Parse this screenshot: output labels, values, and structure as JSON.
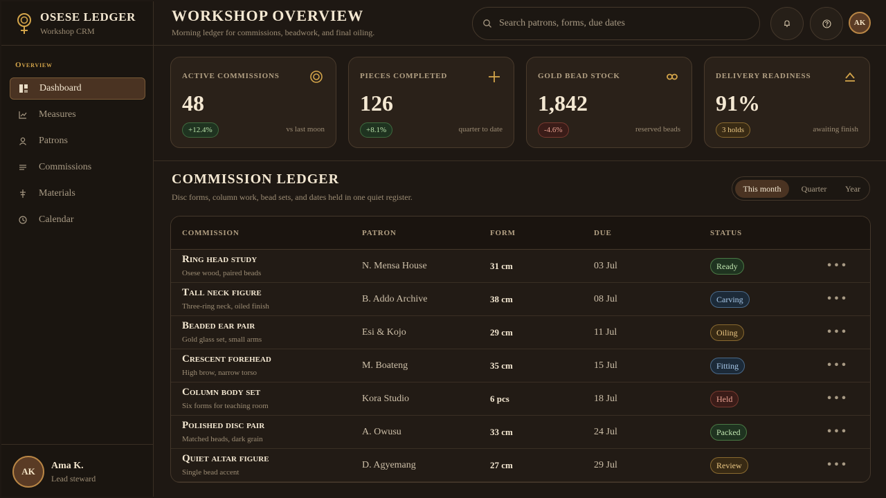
{
  "brand": {
    "title": "OSESE LEDGER",
    "subtitle": "Workshop CRM"
  },
  "sidebar": {
    "section": "Overview",
    "items": [
      {
        "label": "Dashboard",
        "icon": "dashboard-icon",
        "active": true
      },
      {
        "label": "Measures",
        "icon": "chart-icon"
      },
      {
        "label": "Patrons",
        "icon": "person-icon"
      },
      {
        "label": "Commissions",
        "icon": "list-icon"
      },
      {
        "label": "Materials",
        "icon": "materials-icon"
      },
      {
        "label": "Calendar",
        "icon": "clock-icon"
      }
    ],
    "user": {
      "initials": "AK",
      "name": "Ama K.",
      "role": "Lead steward"
    }
  },
  "header": {
    "title": "WORKSHOP OVERVIEW",
    "subtitle": "Morning ledger for commissions, beadwork, and final oiling.",
    "search_placeholder": "Search patrons, forms, due dates",
    "avatar_initials": "AK"
  },
  "stats": [
    {
      "label": "ACTIVE COMMISSIONS",
      "value": "48",
      "delta": "+12.4%",
      "tone": "green",
      "note": "vs last moon",
      "icon": "target-icon"
    },
    {
      "label": "PIECES COMPLETED",
      "value": "126",
      "delta": "+8.1%",
      "tone": "green",
      "note": "quarter to date",
      "icon": "plus-icon"
    },
    {
      "label": "GOLD BEAD STOCK",
      "value": "1,842",
      "delta": "-4.6%",
      "tone": "red",
      "note": "reserved beads",
      "icon": "infinity-icon"
    },
    {
      "label": "DELIVERY READINESS",
      "value": "91%",
      "delta": "3 holds",
      "tone": "amber",
      "note": "awaiting finish",
      "icon": "triangle-icon"
    }
  ],
  "ledger": {
    "title": "COMMISSION LEDGER",
    "subtitle": "Disc forms, column work, bead sets, and dates held in one quiet register.",
    "periods": [
      "This month",
      "Quarter",
      "Year"
    ],
    "active_period": "This month",
    "columns": [
      "COMMISSION",
      "PATRON",
      "FORM",
      "DUE",
      "STATUS"
    ],
    "rows": [
      {
        "title": "Ring head study",
        "desc": "Osese wood, paired beads",
        "patron": "N. Mensa House",
        "form": "31 cm",
        "due": "03 Jul",
        "status": "Ready",
        "tone": "green"
      },
      {
        "title": "Tall neck figure",
        "desc": "Three-ring neck, oiled finish",
        "patron": "B. Addo Archive",
        "form": "38 cm",
        "due": "08 Jul",
        "status": "Carving",
        "tone": "blue"
      },
      {
        "title": "Beaded ear pair",
        "desc": "Gold glass set, small arms",
        "patron": "Esi & Kojo",
        "form": "29 cm",
        "due": "11 Jul",
        "status": "Oiling",
        "tone": "amber"
      },
      {
        "title": "Crescent forehead",
        "desc": "High brow, narrow torso",
        "patron": "M. Boateng",
        "form": "35 cm",
        "due": "15 Jul",
        "status": "Fitting",
        "tone": "blue"
      },
      {
        "title": "Column body set",
        "desc": "Six forms for teaching room",
        "patron": "Kora Studio",
        "form": "6 pcs",
        "due": "18 Jul",
        "status": "Held",
        "tone": "red"
      },
      {
        "title": "Polished disc pair",
        "desc": "Matched heads, dark grain",
        "patron": "A. Owusu",
        "form": "33 cm",
        "due": "24 Jul",
        "status": "Packed",
        "tone": "green"
      },
      {
        "title": "Quiet altar figure",
        "desc": "Single bead accent",
        "patron": "D. Agyemang",
        "form": "27 cm",
        "due": "29 Jul",
        "status": "Review",
        "tone": "amber"
      }
    ]
  },
  "colors": {
    "accent": "#d4a54a",
    "background": "#1e1813",
    "card": "#2a2119"
  }
}
